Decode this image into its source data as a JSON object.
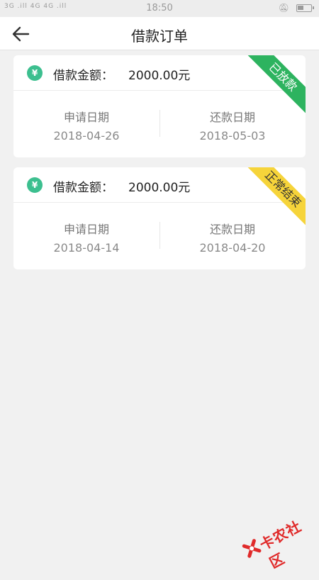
{
  "status_bar": {
    "left": "3G .ill 4G 4G .ill",
    "time": "18:50",
    "icons": [
      "bell-off-icon",
      "battery-icon"
    ]
  },
  "nav": {
    "back_icon": "arrow-left-icon",
    "title": "借款订单"
  },
  "orders": [
    {
      "amount_label": "借款金额：",
      "amount_value": "2000.00元",
      "status": "已放款",
      "status_color": "#2db35f",
      "apply_label": "申请日期",
      "apply_date": "2018-04-26",
      "repay_label": "还款日期",
      "repay_date": "2018-05-03"
    },
    {
      "amount_label": "借款金额：",
      "amount_value": "2000.00元",
      "status": "正常结束",
      "status_color": "#f6d43a",
      "apply_label": "申请日期",
      "apply_date": "2018-04-14",
      "repay_label": "还款日期",
      "repay_date": "2018-04-20"
    }
  ],
  "watermark": {
    "text": "卡农社区",
    "color": "#e02a2a"
  }
}
